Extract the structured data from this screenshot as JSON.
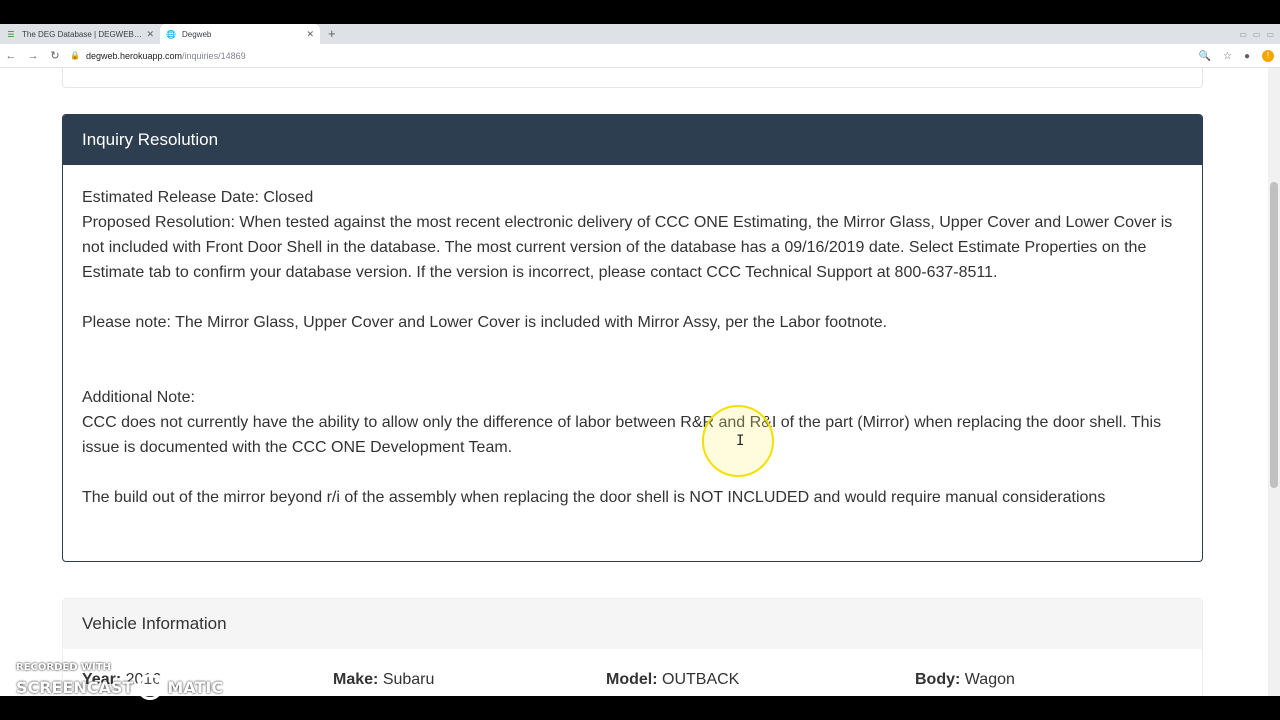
{
  "browser": {
    "tabs": [
      {
        "title": "The DEG Database | DEGWEB.ORG",
        "active": false
      },
      {
        "title": "Degweb",
        "active": true
      }
    ],
    "url_host": "degweb.herokuapp.com",
    "url_path": "/inquiries/14869"
  },
  "resolution": {
    "title": "Inquiry Resolution",
    "release_date": "Estimated Release Date: Closed",
    "proposed": "Proposed Resolution: When tested against the most recent electronic delivery of CCC ONE Estimating, the Mirror Glass, Upper Cover and Lower Cover is not included with Front Door Shell in the database. The most current version of the database has a 09/16/2019 date. Select Estimate Properties on the Estimate tab to confirm your database version. If the version is incorrect, please contact CCC Technical Support at 800-637-8511.",
    "note": "Please note: The Mirror Glass, Upper Cover and Lower Cover is included with Mirror Assy, per the Labor footnote.",
    "additional_label": "Additional Note:",
    "additional_text": "CCC does not currently have the ability to allow only the difference of labor between R&R and R&I of the part (Mirror) when replacing the door shell. This issue is documented with the CCC ONE Development Team.",
    "build_out": "The build out of the mirror beyond r/i of the assembly when replacing the door shell is NOT INCLUDED and would require manual considerations"
  },
  "vehicle": {
    "title": "Vehicle Information",
    "year_label": "Year:",
    "year_value": "2016",
    "make_label": "Make:",
    "make_value": "Subaru",
    "model_label": "Model:",
    "model_value": "OUTBACK",
    "body_label": "Body:",
    "body_value": "Wagon"
  },
  "watermark": {
    "top": "RECORDED WITH",
    "left": "SCREENCAST",
    "right": "MATIC"
  }
}
